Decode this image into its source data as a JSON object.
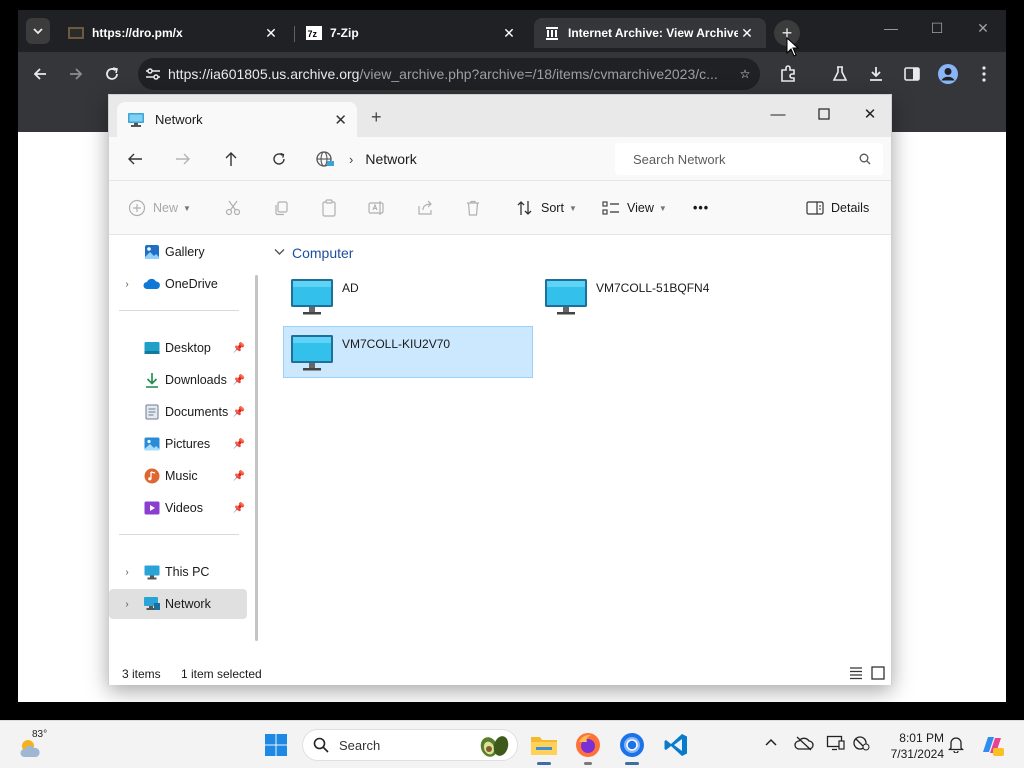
{
  "browser": {
    "tabs": [
      {
        "title": "https://dro.pm/x"
      },
      {
        "title": "7-Zip"
      },
      {
        "title": "Internet Archive: View Archive"
      }
    ],
    "url_host": "https://ia601805.us.archive.org",
    "url_path": "/view_archive.php?archive=/18/items/cvmarchive2023/c..."
  },
  "explorer": {
    "tab_title": "Network",
    "breadcrumb": "Network",
    "search_placeholder": "Search Network",
    "commands": {
      "new": "New",
      "sort": "Sort",
      "view": "View",
      "more": "•••",
      "details": "Details"
    },
    "sidebar": {
      "gallery": "Gallery",
      "onedrive": "OneDrive",
      "desktop": "Desktop",
      "downloads": "Downloads",
      "documents": "Documents",
      "pictures": "Pictures",
      "music": "Music",
      "videos": "Videos",
      "this_pc": "This PC",
      "network": "Network"
    },
    "group_header": "Computer",
    "items": [
      {
        "name": "AD"
      },
      {
        "name": "VM7COLL-51BQFN4"
      },
      {
        "name": "VM7COLL-KIU2V70"
      }
    ],
    "status": {
      "count": "3 items",
      "selected": "1 item selected"
    }
  },
  "taskbar": {
    "temperature": "83°",
    "search_label": "Search",
    "time": "8:01 PM",
    "date": "7/31/2024"
  }
}
